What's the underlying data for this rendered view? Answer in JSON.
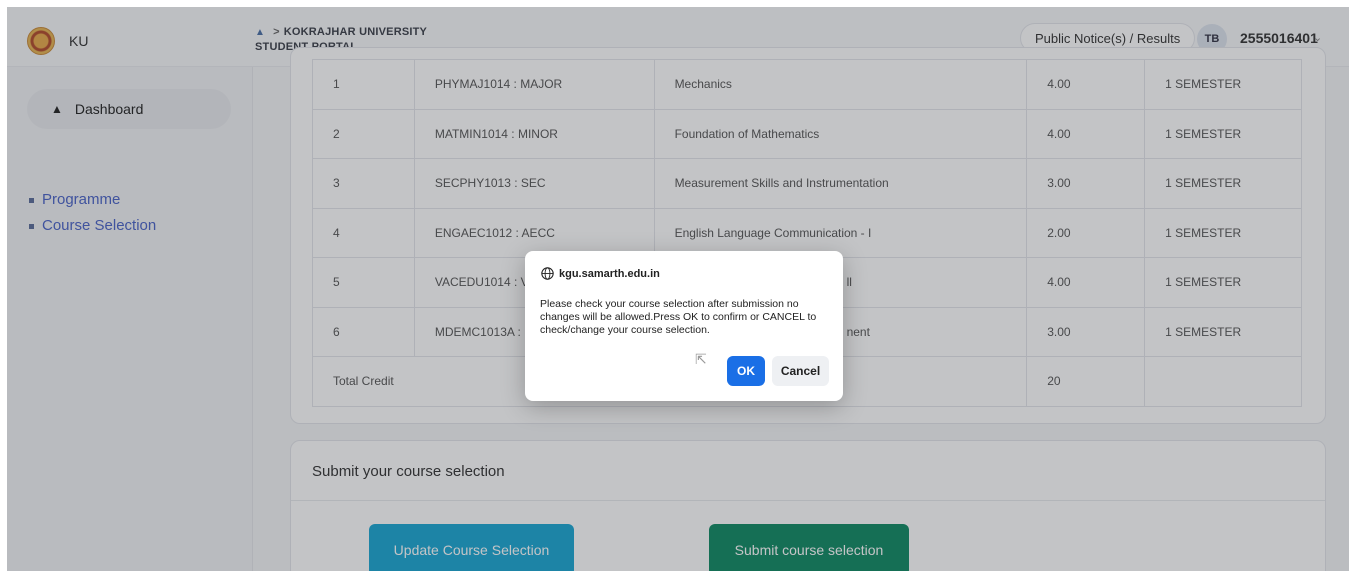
{
  "topbar": {
    "brand_name": "KU",
    "breadcrumb_home_icon": "home-icon",
    "breadcrumb_sep": ">",
    "breadcrumb_line1": "KOKRAJHAR UNIVERSITY",
    "breadcrumb_line2": "STUDENT PORTAL",
    "notice_label": "Public Notice(s) / Results",
    "avatar_initials": "TB",
    "user_id": "2555016401"
  },
  "sidebar": {
    "dashboard_label": "Dashboard",
    "links": [
      {
        "label": "Programme"
      },
      {
        "label": "Course Selection"
      }
    ]
  },
  "courses": {
    "rows": [
      {
        "sno": "1",
        "code": "PHYMAJ1014 : MAJOR",
        "title": "Mechanics",
        "credit": "4.00",
        "semester": "1 SEMESTER"
      },
      {
        "sno": "2",
        "code": "MATMIN1014 : MINOR",
        "title": "Foundation of Mathematics",
        "credit": "4.00",
        "semester": "1 SEMESTER"
      },
      {
        "sno": "3",
        "code": "SECPHY1013 : SEC",
        "title": "Measurement Skills and Instrumentation",
        "credit": "3.00",
        "semester": "1 SEMESTER"
      },
      {
        "sno": "4",
        "code": "ENGAEC1012 : AECC",
        "title": "English Language Communication - I",
        "credit": "2.00",
        "semester": "1 SEMESTER"
      },
      {
        "sno": "5",
        "code": "VACEDU1014 : V/",
        "title": "ll",
        "credit": "4.00",
        "semester": "1 SEMESTER"
      },
      {
        "sno": "6",
        "code": "MDEMC1013A : I",
        "title": "nent",
        "credit": "3.00",
        "semester": "1 SEMESTER"
      }
    ],
    "total_label": "Total Credit",
    "total_value": "20"
  },
  "submit_section": {
    "heading": "Submit your course selection",
    "update_label": "Update Course Selection",
    "submit_label": "Submit course selection"
  },
  "dialog": {
    "origin": "kgu.samarth.edu.in",
    "message": "Please check your course selection after submission no changes will be allowed.Press OK to confirm or CANCEL to check/change your course selection.",
    "ok_label": "OK",
    "cancel_label": "Cancel"
  },
  "colors": {
    "update_button": "#1aa7d3",
    "submit_button": "#0f8a63",
    "ok_button": "#1a6fe6",
    "link": "#4a63c8"
  }
}
